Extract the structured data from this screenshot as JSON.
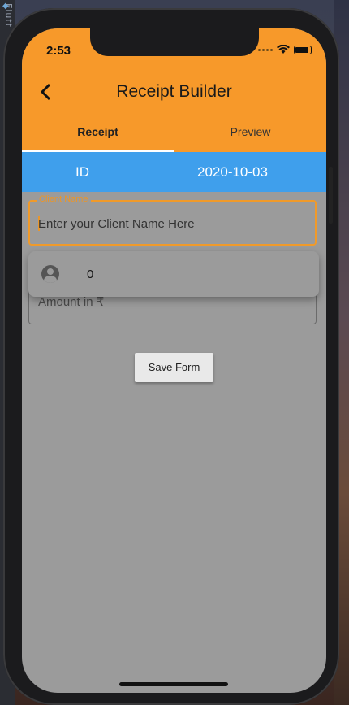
{
  "ide": {
    "label": "Flutt"
  },
  "status": {
    "time": "2:53"
  },
  "appbar": {
    "title": "Receipt Builder"
  },
  "tabs": [
    {
      "label": "Receipt"
    },
    {
      "label": "Preview"
    }
  ],
  "info": {
    "id_label": "ID",
    "date": "2020-10-03"
  },
  "form": {
    "client_name_label": "Client Name",
    "client_name_placeholder": "Enter your Client Name Here",
    "amount_placeholder": "Amount in ₹",
    "dropdown_value": "0",
    "save_label": "Save Form"
  },
  "colors": {
    "appbar": "#f7992a",
    "info_row": "#3f9fec",
    "screen_bg": "#9b9b9b"
  }
}
